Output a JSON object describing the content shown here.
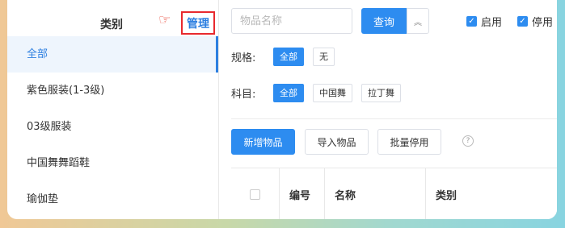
{
  "sidebar": {
    "title": "类别",
    "manage_label": "管理",
    "pointer_glyph": "☞",
    "items": [
      {
        "label": "全部",
        "active": true
      },
      {
        "label": "紫色服装(1-3级)"
      },
      {
        "label": "03级服装"
      },
      {
        "label": "中国舞舞蹈鞋"
      },
      {
        "label": "瑜伽垫"
      }
    ]
  },
  "search": {
    "placeholder": "物品名称",
    "query_label": "查询",
    "collapse_glyph": "︽"
  },
  "toggles": {
    "enabled_label": "启用",
    "disabled_label": "停用",
    "check_glyph": "✓"
  },
  "filters": {
    "spec": {
      "label": "规格:",
      "tags": [
        "全部",
        "无"
      ]
    },
    "subject": {
      "label": "科目:",
      "tags": [
        "全部",
        "中国舞",
        "拉丁舞"
      ]
    }
  },
  "actions": {
    "add_label": "新增物品",
    "import_label": "导入物品",
    "batch_disable_label": "批量停用",
    "help_glyph": "?"
  },
  "table": {
    "columns": [
      "编号",
      "名称",
      "类别"
    ]
  },
  "colors": {
    "accent": "#2d8cf0",
    "highlight_border": "#e8292e"
  }
}
